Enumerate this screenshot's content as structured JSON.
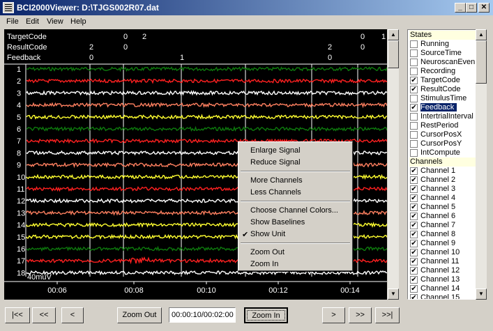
{
  "window": {
    "title": "BCI2000Viewer: D:\\TJGS002R07.dat",
    "minimize": "_",
    "maximize": "□",
    "close": "✕"
  },
  "menu": [
    "File",
    "Edit",
    "View",
    "Help"
  ],
  "states_header": [
    {
      "name": "TargetCode",
      "values": [
        "0",
        "2",
        "0",
        "1"
      ]
    },
    {
      "name": "ResultCode",
      "values": [
        "2",
        "0",
        "2",
        "0"
      ]
    },
    {
      "name": "Feedback",
      "values": [
        "0",
        "1",
        "0"
      ]
    }
  ],
  "channels": [
    "1",
    "2",
    "3",
    "4",
    "5",
    "6",
    "7",
    "8",
    "9",
    "10",
    "11",
    "12",
    "13",
    "14",
    "15",
    "16",
    "17",
    "18"
  ],
  "channel_colors": [
    "#0d7a0d",
    "#ff2020",
    "#ffffff",
    "#ff8060",
    "#ffff30",
    "#0d7a0d",
    "#ff2020",
    "#ffffff",
    "#ff8060",
    "#ffff30",
    "#ff2020",
    "#ffffff",
    "#ff8060",
    "#ffff30",
    "#ffff30",
    "#0d7a0d",
    "#ff2020",
    "#ffffff"
  ],
  "unit_label": "40muV",
  "time_ticks": [
    "00:06",
    "00:08",
    "00:10",
    "00:12",
    "00:14"
  ],
  "context_menu": {
    "enlarge": "Enlarge Signal",
    "reduce": "Reduce Signal",
    "more": "More Channels",
    "less": "Less Channels",
    "colors": "Choose Channel Colors...",
    "baselines": "Show Baselines",
    "unit": "Show Unit",
    "unit_checked": true,
    "zoom_out": "Zoom Out",
    "zoom_in": "Zoom In"
  },
  "state_list": {
    "states_label": "States",
    "states": [
      {
        "label": "Running",
        "checked": false
      },
      {
        "label": "SourceTime",
        "checked": false
      },
      {
        "label": "NeuroscanEven",
        "checked": false
      },
      {
        "label": "Recording",
        "checked": false
      },
      {
        "label": "TargetCode",
        "checked": true
      },
      {
        "label": "ResultCode",
        "checked": true
      },
      {
        "label": "StimulusTime",
        "checked": false
      },
      {
        "label": "Feedback",
        "checked": true,
        "selected": true
      },
      {
        "label": "IntertrialInterval",
        "checked": false
      },
      {
        "label": "RestPeriod",
        "checked": false
      },
      {
        "label": "CursorPosX",
        "checked": false
      },
      {
        "label": "CursorPosY",
        "checked": false
      },
      {
        "label": "IntCompute",
        "checked": false
      }
    ],
    "channels_label": "Channels",
    "channels": [
      {
        "label": "Channel 1",
        "checked": true
      },
      {
        "label": "Channel 2",
        "checked": true
      },
      {
        "label": "Channel 3",
        "checked": true
      },
      {
        "label": "Channel 4",
        "checked": true
      },
      {
        "label": "Channel 5",
        "checked": true
      },
      {
        "label": "Channel 6",
        "checked": true
      },
      {
        "label": "Channel 7",
        "checked": true
      },
      {
        "label": "Channel 8",
        "checked": true
      },
      {
        "label": "Channel 9",
        "checked": true
      },
      {
        "label": "Channel 10",
        "checked": true
      },
      {
        "label": "Channel 11",
        "checked": true
      },
      {
        "label": "Channel 12",
        "checked": true
      },
      {
        "label": "Channel 13",
        "checked": true
      },
      {
        "label": "Channel 14",
        "checked": true
      },
      {
        "label": "Channel 15",
        "checked": true
      }
    ]
  },
  "toolbar": {
    "first": "|<<",
    "page_back": "<<",
    "back": "<",
    "zoom_out": "Zoom Out",
    "time_position": "00:00:10/00:02:00",
    "zoom_in": "Zoom In",
    "forward": ">",
    "page_forward": ">>",
    "last": ">>|"
  }
}
